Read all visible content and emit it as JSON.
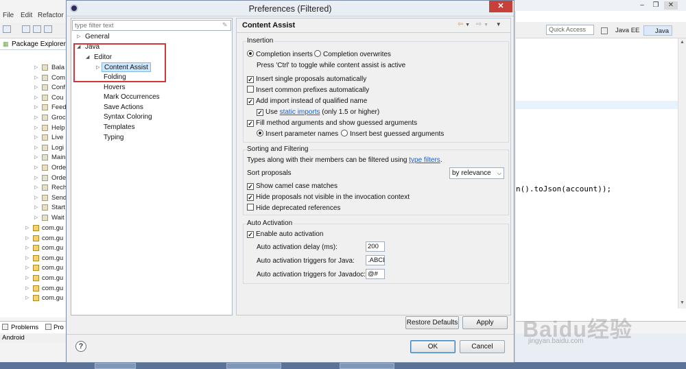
{
  "ide": {
    "menu": [
      "File",
      "Edit",
      "Refactor"
    ],
    "package_explorer_title": "Package Explorer",
    "tree_items": [
      "Bala",
      "Com",
      "Conf",
      "Cou",
      "Feed",
      "Groc",
      "Help",
      "Live",
      "Logi",
      "Main",
      "Orde",
      "Orde",
      "Rech",
      "Send",
      "Start",
      "Wait"
    ],
    "package_items": [
      "com.gu",
      "com.gu",
      "com.gu",
      "com.gu",
      "com.gu",
      "com.gu",
      "com.gu",
      "com.gu"
    ],
    "bottom_tabs": [
      "Problems",
      "Pro"
    ],
    "bottom_label": "Android",
    "quick_access": "Quick Access",
    "perspectives": [
      "Java EE",
      "Java"
    ],
    "editor_code": "n().toJson(account));",
    "watermark_main": "Baidu经验",
    "watermark_sub": "jingyan.baidu.com"
  },
  "dialog": {
    "title": "Preferences (Filtered)",
    "close": "✕",
    "filter_placeholder": "type filter text",
    "tree": {
      "general": "General",
      "java": "Java",
      "editor": "Editor",
      "content_assist": "Content Assist",
      "editor_children": [
        "Folding",
        "Hovers",
        "Mark Occurrences",
        "Save Actions",
        "Syntax Coloring",
        "Templates",
        "Typing"
      ]
    },
    "page_title": "Content Assist",
    "insertion": {
      "label": "Insertion",
      "completion_inserts": "Completion inserts",
      "completion_overwrites": "Completion overwrites",
      "toggle_hint": "Press 'Ctrl' to toggle while content assist is active",
      "insert_single": "Insert single proposals automatically",
      "insert_prefixes": "Insert common prefixes automatically",
      "add_import": "Add import instead of qualified name",
      "use": "Use",
      "static_imports": "static imports",
      "only_15": "(only 1.5 or higher)",
      "fill_method": "Fill method arguments and show guessed arguments",
      "insert_param_names": "Insert parameter names",
      "insert_best_guessed": "Insert best guessed arguments"
    },
    "sorting": {
      "label": "Sorting and Filtering",
      "types_text": "Types along with their members can be filtered using",
      "type_filters": "type filters",
      "period": ".",
      "sort_label": "Sort proposals",
      "sort_value": "by relevance",
      "camel_case": "Show camel case matches",
      "hide_not_visible": "Hide proposals not visible in the invocation context",
      "hide_deprecated": "Hide deprecated references"
    },
    "auto_activation": {
      "label": "Auto Activation",
      "enable": "Enable auto activation",
      "delay_label": "Auto activation delay (ms):",
      "delay_value": "200",
      "java_label": "Auto activation triggers for Java:",
      "java_value": ".ABCD",
      "javadoc_label": "Auto activation triggers for Javadoc:",
      "javadoc_value": "@#"
    },
    "buttons": {
      "restore_defaults": "Restore Defaults",
      "apply": "Apply",
      "ok": "OK",
      "cancel": "Cancel"
    },
    "help": "?"
  },
  "colors": {
    "highlight_box": "#d0363c",
    "link": "#1a5fcc",
    "selection": "#cde8ff"
  }
}
